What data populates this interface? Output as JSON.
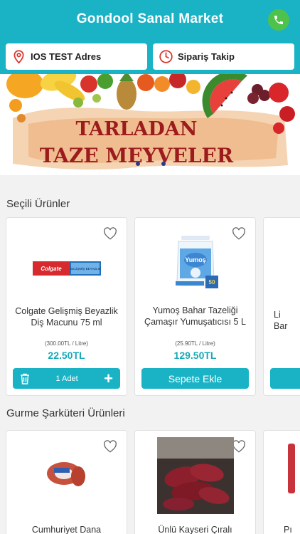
{
  "header": {
    "title": "Gondool Sanal Market",
    "address_label": "IOS TEST Adres",
    "tracking_label": "Sipariş Takip"
  },
  "banner": {
    "line1": "TARLADAN",
    "line2": "TAZE MEYVELER"
  },
  "sections": [
    {
      "title": "Seçili Ürünler",
      "products": [
        {
          "name": "Colgate Gelişmiş Beyazlik Diş Macunu 75 ml",
          "unit_price": "(300.00TL / Litre)",
          "price": "22.50TL",
          "quantity_label": "1 Adet",
          "brand_text": "Colgate",
          "pack_text": "GELİŞMİŞ BEYAZLIK"
        },
        {
          "name": "Yumoş Bahar Tazeliği Çamaşır Yumuşatıcısı 5 L",
          "unit_price": "(25.90TL / Litre)",
          "price": "129.50TL",
          "button_label": "Sepete Ekle",
          "brand_text": "Yumoş",
          "badge_text": "50"
        },
        {
          "name_peek": "Li\nBar"
        }
      ]
    },
    {
      "title": "Gurme Şarküteri Ürünleri",
      "products": [
        {
          "name": "Cumhuriyet Dana"
        },
        {
          "name": "Ünlü Kayseri Çıralı"
        },
        {
          "name_peek": "Pı"
        }
      ]
    }
  ],
  "colors": {
    "primary": "#1ab3c6",
    "price": "#16a9b9",
    "call": "#4fc24b"
  }
}
